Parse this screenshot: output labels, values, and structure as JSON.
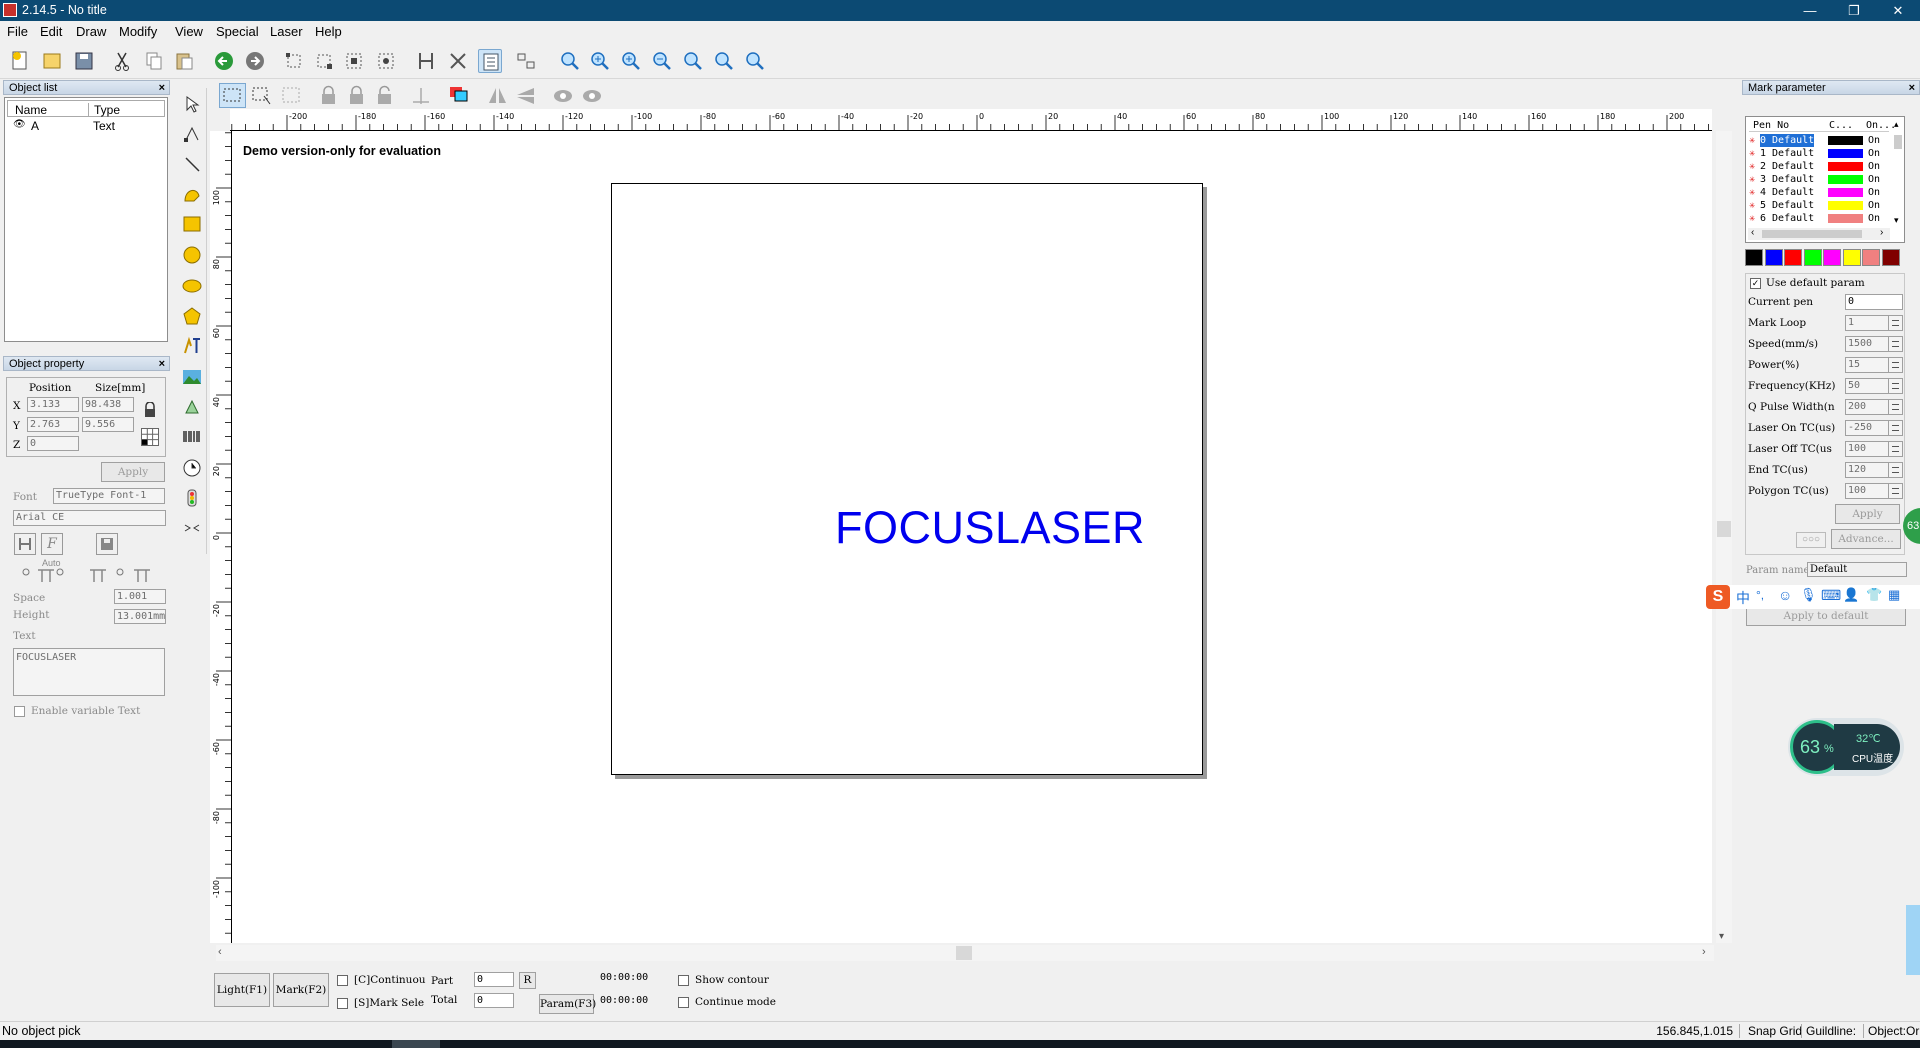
{
  "window": {
    "title": "2.14.5 - No title"
  },
  "menu": [
    "File",
    "Edit",
    "Draw",
    "Modify",
    "View",
    "Special",
    "Laser",
    "Help"
  ],
  "object_list": {
    "title": "Object list",
    "col_name": "Name",
    "col_type": "Type",
    "rows": [
      {
        "name": "A",
        "type": "Text"
      }
    ]
  },
  "object_property": {
    "title": "Object property",
    "position_label": "Position",
    "size_label": "Size[mm]",
    "x_label": "X",
    "x_pos": "3.133",
    "x_size": "98.438",
    "y_label": "Y",
    "y_pos": "2.763",
    "y_size": "9.556",
    "z_label": "Z",
    "z_pos": "0",
    "apply": "Apply",
    "font_label": "Font",
    "font_type": "TrueType Font-1",
    "font_name": "Arial CE",
    "auto_label": "Auto",
    "space_label": "Space",
    "space_value": "1.001",
    "height_label": "Height",
    "height_value": "13.001mm",
    "text_label": "Text",
    "text_value": "FOCUSLASER",
    "enable_variable": "Enable variable Text"
  },
  "canvas": {
    "demo_notice": "Demo version-only for evaluation",
    "main_text": "FOCUSLASER",
    "ruler_h": [
      "-200",
      "-180",
      "-160",
      "-140",
      "-120",
      "-100",
      "-80",
      "-60",
      "-40",
      "-20",
      "0",
      "20",
      "40",
      "60",
      "80",
      "100",
      "120",
      "140",
      "160",
      "180",
      "200"
    ],
    "ruler_v": [
      "100",
      "80",
      "60",
      "40",
      "20",
      "0",
      "-20",
      "-40",
      "-60",
      "-80",
      "-100"
    ]
  },
  "bottom_bar": {
    "light": "Light(F1)",
    "mark": "Mark(F2)",
    "continuous": "[C]Continuou",
    "part_label": "Part",
    "part_value": "0",
    "r_button": "R",
    "mark_sel": "[S]Mark Sele",
    "total_label": "Total",
    "total_value": "0",
    "param": "Param(F3)",
    "time1": "00:00:00",
    "time2": "00:00:00",
    "show_contour": "Show contour",
    "continue_mode": "Continue mode"
  },
  "mark_parameter": {
    "title": "Mark parameter",
    "col_pen": "Pen No",
    "col_color": "C...",
    "col_on": "On...",
    "pens": [
      {
        "label": "0 Default",
        "color": "#000000",
        "on": "On"
      },
      {
        "label": "1 Default",
        "color": "#0000ff",
        "on": "On"
      },
      {
        "label": "2 Default",
        "color": "#ff0000",
        "on": "On"
      },
      {
        "label": "3 Default",
        "color": "#00ff00",
        "on": "On"
      },
      {
        "label": "4 Default",
        "color": "#ff00ff",
        "on": "On"
      },
      {
        "label": "5 Default",
        "color": "#ffff00",
        "on": "On"
      },
      {
        "label": "6 Default",
        "color": "#f08080",
        "on": "On"
      }
    ],
    "palette": [
      "#000000",
      "#0000ff",
      "#ff0000",
      "#00ff00",
      "#ff00ff",
      "#ffff00",
      "#f08080",
      "#800000"
    ],
    "use_default": "Use default param",
    "params": [
      {
        "label": "Current pen",
        "value": "0"
      },
      {
        "label": "Mark Loop",
        "value": "1"
      },
      {
        "label": "Speed(mm/s)",
        "value": "1500"
      },
      {
        "label": "Power(%)",
        "value": "15"
      },
      {
        "label": "Frequency(KHz)",
        "value": "50"
      },
      {
        "label": "Q Pulse Width(n",
        "value": "200"
      },
      {
        "label": "Laser On TC(us)",
        "value": "-250"
      },
      {
        "label": "Laser Off TC(us",
        "value": "100"
      },
      {
        "label": "End TC(us)",
        "value": "120"
      },
      {
        "label": "Polygon TC(us)",
        "value": "100"
      }
    ],
    "apply": "Apply",
    "advance": "Advance...",
    "param_name_label": "Param name",
    "param_name_value": "Default",
    "apply_default": "Apply to default"
  },
  "overlay": {
    "cpu_percent": "63",
    "percent_sign": "%",
    "temp": "32℃",
    "cpu_label": "CPU温度",
    "side_badge": "63",
    "ime_chars": [
      "中",
      "°,"
    ]
  },
  "status": {
    "left": "No object pick",
    "coords": "156.845,1.015",
    "snap": "Snap Grid",
    "guideline": "Guildline:",
    "object": "Object:Or"
  }
}
